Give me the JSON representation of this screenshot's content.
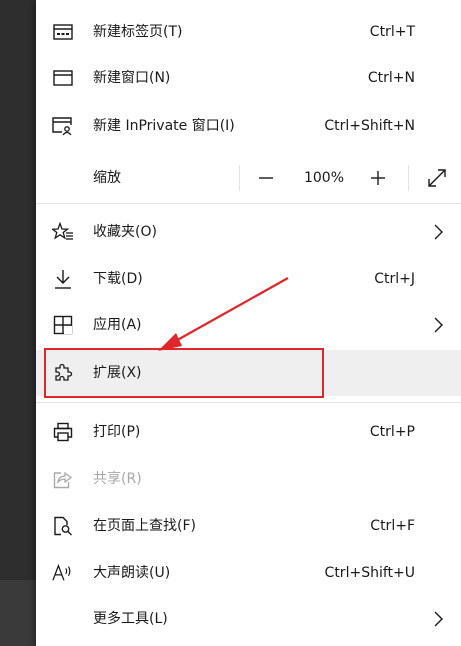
{
  "menu": {
    "new_tab": {
      "label": "新建标签页(T)",
      "shortcut": "Ctrl+T",
      "icon": "new-tab-icon"
    },
    "new_window": {
      "label": "新建窗口(N)",
      "shortcut": "Ctrl+N",
      "icon": "new-window-icon"
    },
    "new_inprivate": {
      "label": "新建 InPrivate 窗口(I)",
      "shortcut": "Ctrl+Shift+N",
      "icon": "inprivate-window-icon"
    },
    "zoom": {
      "label": "缩放",
      "value": "100%",
      "minus": "—",
      "plus": "+"
    },
    "favorites": {
      "label": "收藏夹(O)",
      "icon": "favorites-icon"
    },
    "downloads": {
      "label": "下载(D)",
      "shortcut": "Ctrl+J",
      "icon": "download-icon"
    },
    "apps": {
      "label": "应用(A)",
      "icon": "apps-icon"
    },
    "extensions": {
      "label": "扩展(X)",
      "icon": "extensions-puzzle-icon"
    },
    "print": {
      "label": "打印(P)",
      "shortcut": "Ctrl+P",
      "icon": "print-icon"
    },
    "share": {
      "label": "共享(R)",
      "icon": "share-icon"
    },
    "find": {
      "label": "在页面上查找(F)",
      "shortcut": "Ctrl+F",
      "icon": "find-on-page-icon"
    },
    "read_aloud": {
      "label": "大声朗读(U)",
      "shortcut": "Ctrl+Shift+U",
      "icon": "read-aloud-icon"
    },
    "more_tools": {
      "label": "更多工具(L)"
    }
  },
  "colors": {
    "annotation": "#e0262b",
    "menu_bg": "#ffffff",
    "hover_bg": "#efefef",
    "disabled_text": "#a8a8a8"
  }
}
